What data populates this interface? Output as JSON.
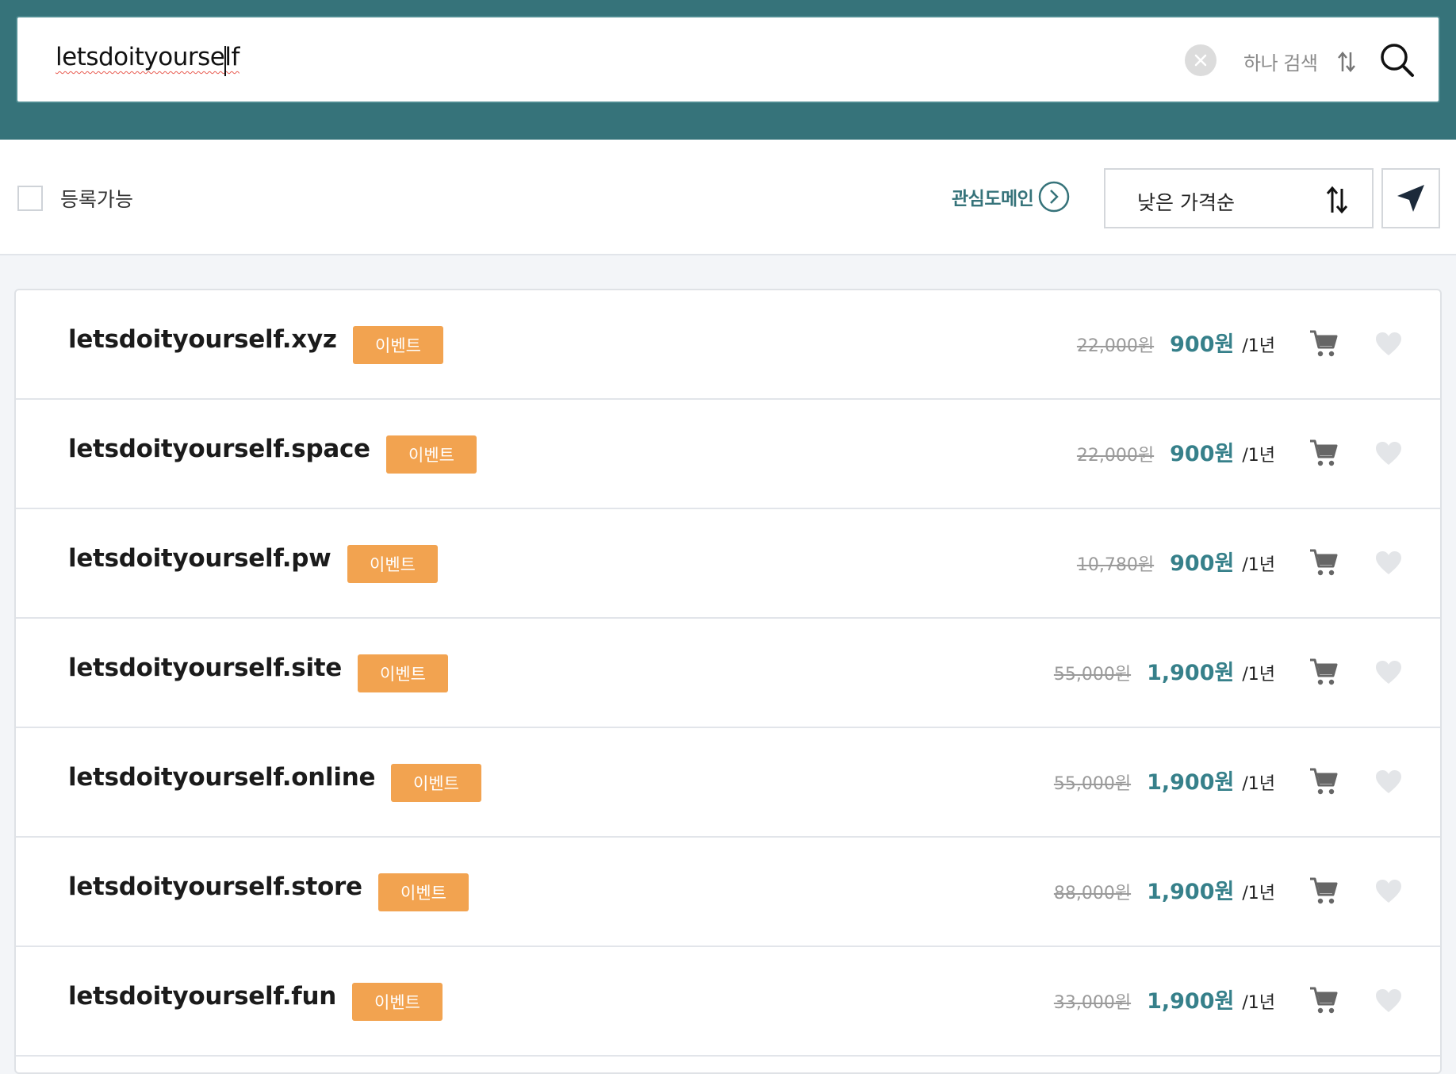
{
  "search": {
    "query": "letsdoityourself",
    "single_search_label": "하나 검색"
  },
  "filter": {
    "available_label": "등록가능",
    "favorites_label": "관심도메인",
    "sort_label": "낮은 가격순"
  },
  "colors": {
    "topbar": "#36737a",
    "accent": "#36808a",
    "badge": "#f2a350"
  },
  "results": [
    {
      "domain": "letsdoityourself.xyz",
      "badge": "이벤트",
      "original_price": "22,000원",
      "price": "900원",
      "period": "/1년"
    },
    {
      "domain": "letsdoityourself.space",
      "badge": "이벤트",
      "original_price": "22,000원",
      "price": "900원",
      "period": "/1년"
    },
    {
      "domain": "letsdoityourself.pw",
      "badge": "이벤트",
      "original_price": "10,780원",
      "price": "900원",
      "period": "/1년"
    },
    {
      "domain": "letsdoityourself.site",
      "badge": "이벤트",
      "original_price": "55,000원",
      "price": "1,900원",
      "period": "/1년"
    },
    {
      "domain": "letsdoityourself.online",
      "badge": "이벤트",
      "original_price": "55,000원",
      "price": "1,900원",
      "period": "/1년"
    },
    {
      "domain": "letsdoityourself.store",
      "badge": "이벤트",
      "original_price": "88,000원",
      "price": "1,900원",
      "period": "/1년"
    },
    {
      "domain": "letsdoityourself.fun",
      "badge": "이벤트",
      "original_price": "33,000원",
      "price": "1,900원",
      "period": "/1년"
    }
  ]
}
